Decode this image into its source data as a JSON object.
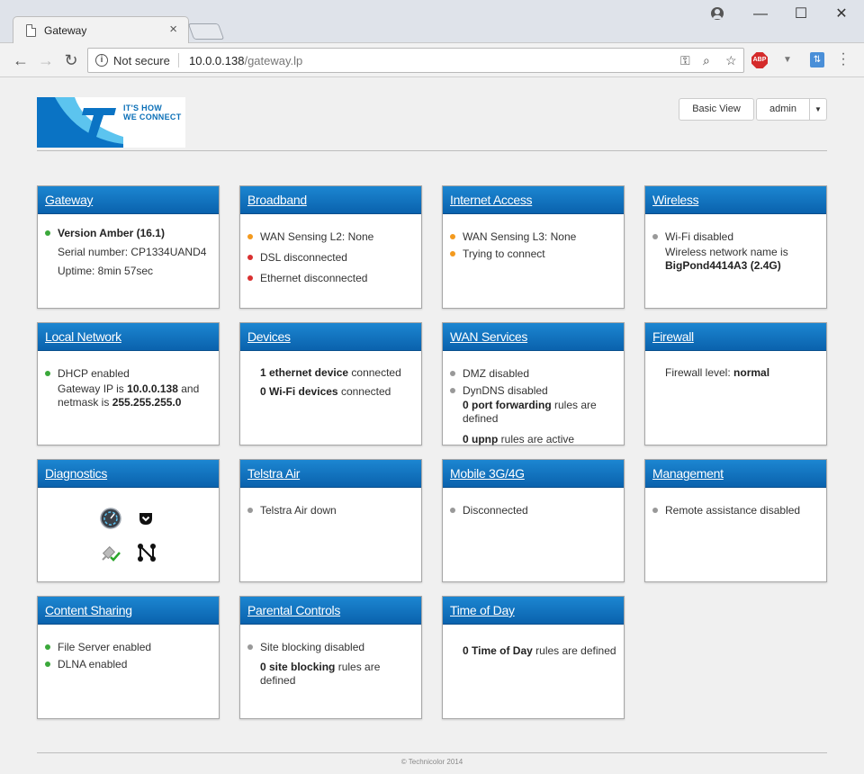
{
  "browser": {
    "tab_title": "Gateway",
    "tab_close": "×",
    "security_label": "Not secure",
    "url_host": "10.0.0.138",
    "url_path": "/gateway.lp",
    "abp_label": "ABP",
    "window_controls": {
      "minimize": "—",
      "maximize": "☐",
      "close": "✕"
    }
  },
  "header": {
    "logo_line1": "IT'S HOW",
    "logo_line2": "WE CONNECT",
    "basic_view": "Basic View",
    "user": "admin"
  },
  "cards": {
    "gateway": {
      "title": "Gateway",
      "version": "Version Amber (16.1)",
      "serial": "Serial number: CP1334UAND4",
      "uptime": "Uptime: 8min 57sec"
    },
    "broadband": {
      "title": "Broadband",
      "l2": "WAN Sensing L2: None",
      "dsl": "DSL disconnected",
      "eth": "Ethernet disconnected"
    },
    "internet": {
      "title": "Internet Access",
      "l3": "WAN Sensing L3: None",
      "trying": "Trying to connect"
    },
    "wireless": {
      "title": "Wireless",
      "wifi": "Wi-Fi disabled",
      "name_label": "Wireless network name is",
      "ssid": "BigPond4414A3 (2.4G)"
    },
    "local": {
      "title": "Local Network",
      "dhcp": "DHCP enabled",
      "ip_prefix": "Gateway IP is",
      "ip": "10.0.0.138",
      "ip_and": "and",
      "mask_prefix": "netmask is",
      "mask": "255.255.255.0"
    },
    "devices": {
      "title": "Devices",
      "eth_count": "1 ethernet device",
      "eth_suffix": "connected",
      "wifi_count": "0 Wi-Fi devices",
      "wifi_suffix": "connected"
    },
    "wan": {
      "title": "WAN Services",
      "dmz": "DMZ disabled",
      "dyndns": "DynDNS disabled",
      "pf_count": "0 port forwarding",
      "pf_suffix": "rules are defined",
      "upnp_count": "0 upnp",
      "upnp_suffix": "rules are active"
    },
    "firewall": {
      "title": "Firewall",
      "level_prefix": "Firewall level:",
      "level": "normal"
    },
    "diagnostics": {
      "title": "Diagnostics"
    },
    "telstra_air": {
      "title": "Telstra Air",
      "status": "Telstra Air down"
    },
    "mobile": {
      "title": "Mobile 3G/4G",
      "status": "Disconnected"
    },
    "management": {
      "title": "Management",
      "status": "Remote assistance disabled"
    },
    "content": {
      "title": "Content Sharing",
      "file": "File Server enabled",
      "dlna": "DLNA enabled"
    },
    "parental": {
      "title": "Parental Controls",
      "site": "Site blocking disabled",
      "count": "0 site blocking",
      "suffix": "rules are defined"
    },
    "tod": {
      "title": "Time of Day",
      "count": "0 Time of Day",
      "suffix": "rules are defined"
    }
  },
  "footer": {
    "copyright": "© Technicolor 2014"
  },
  "colors": {
    "card_header": "#0a6fb7",
    "status_green": "#3aa83a",
    "status_orange": "#f39a1e",
    "status_red": "#d93030",
    "status_gray": "#999999"
  },
  "icons": [
    "back-icon",
    "forward-icon",
    "reload-icon",
    "info-icon",
    "key-icon",
    "zoom-icon",
    "star-icon",
    "abp-icon",
    "menu-icon",
    "speed-gauge-icon",
    "pocket-icon",
    "network-check-icon",
    "network-graph-icon"
  ]
}
